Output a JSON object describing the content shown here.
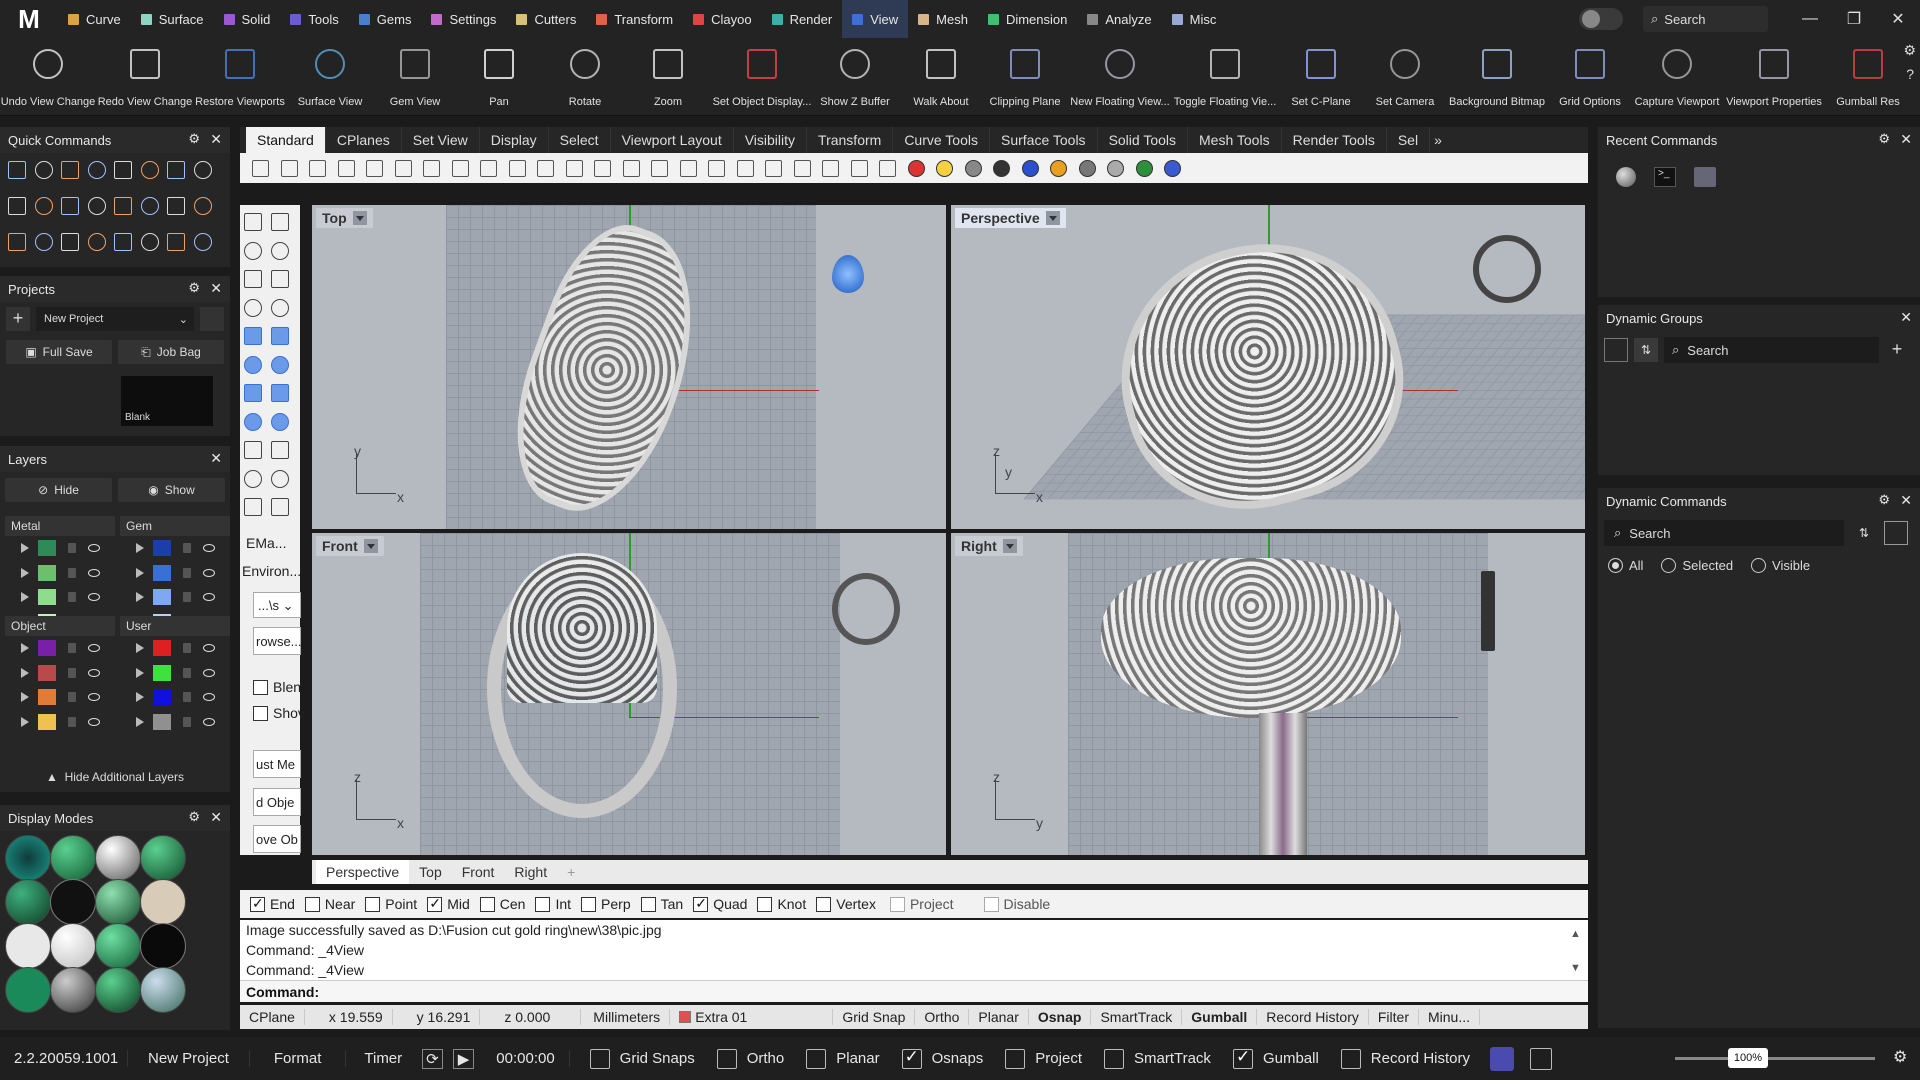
{
  "menu": {
    "logo": "M",
    "tabs": [
      {
        "label": "Curve",
        "color": "#d9a441"
      },
      {
        "label": "Surface",
        "color": "#8fd3c1"
      },
      {
        "label": "Solid",
        "color": "#9b59d0"
      },
      {
        "label": "Tools",
        "color": "#6a5ecf"
      },
      {
        "label": "Gems",
        "color": "#4a7fd0"
      },
      {
        "label": "Settings",
        "color": "#c46acb"
      },
      {
        "label": "Cutters",
        "color": "#d8c07a"
      },
      {
        "label": "Transform",
        "color": "#e0614a"
      },
      {
        "label": "Clayoo",
        "color": "#e04545"
      },
      {
        "label": "Render",
        "color": "#3ab0a8"
      },
      {
        "label": "View",
        "color": "#3d6fd6"
      },
      {
        "label": "Mesh",
        "color": "#d8b48a"
      },
      {
        "label": "Dimension",
        "color": "#3fbf6f"
      },
      {
        "label": "Analyze",
        "color": "#888888"
      },
      {
        "label": "Misc",
        "color": "#9aa8d6"
      }
    ],
    "search_placeholder": "Search"
  },
  "ribbon": [
    {
      "label": "Undo View Change",
      "icon": "undo-view-icon"
    },
    {
      "label": "Redo View Change",
      "icon": "redo-view-icon"
    },
    {
      "label": "Restore Viewports",
      "icon": "restore-viewports-icon"
    },
    {
      "label": "Surface View",
      "icon": "surface-view-icon"
    },
    {
      "label": "Gem View",
      "icon": "gem-view-icon"
    },
    {
      "label": "Pan",
      "icon": "pan-hand-icon"
    },
    {
      "label": "Rotate",
      "icon": "rotate-icon"
    },
    {
      "label": "Zoom",
      "icon": "zoom-icon"
    },
    {
      "label": "Set Object Display...",
      "icon": "object-display-icon"
    },
    {
      "label": "Show Z Buffer",
      "icon": "z-buffer-icon"
    },
    {
      "label": "Walk About",
      "icon": "walk-about-icon"
    },
    {
      "label": "Clipping Plane",
      "icon": "clipping-plane-icon"
    },
    {
      "label": "New Floating View...",
      "icon": "floating-view-icon"
    },
    {
      "label": "Toggle Floating Vie...",
      "icon": "toggle-floating-icon"
    },
    {
      "label": "Set C-Plane",
      "icon": "cplane-icon"
    },
    {
      "label": "Set Camera",
      "icon": "camera-icon"
    },
    {
      "label": "Background Bitmap",
      "icon": "background-bitmap-icon"
    },
    {
      "label": "Grid Options",
      "icon": "grid-options-icon"
    },
    {
      "label": "Capture Viewport",
      "icon": "capture-viewport-icon"
    },
    {
      "label": "Viewport Properties",
      "icon": "viewport-properties-icon"
    },
    {
      "label": "Gumball Res",
      "icon": "gumball-icon"
    }
  ],
  "quick_commands": {
    "title": "Quick Commands"
  },
  "projects": {
    "title": "Projects",
    "project_name": "New Project",
    "full_save": "Full Save",
    "job_bag": "Job Bag",
    "thumb_label": "Blank"
  },
  "layers": {
    "title": "Layers",
    "hide": "Hide",
    "show": "Show",
    "groups": [
      {
        "name": "Metal",
        "colors": [
          "#2e8b57",
          "#6dbf6d",
          "#8fdc8f",
          "#c4f0c4"
        ]
      },
      {
        "name": "Gem",
        "colors": [
          "#1a3fa8",
          "#3a6fd6",
          "#7fa8f0",
          "#b8cff7"
        ]
      },
      {
        "name": "Object",
        "colors": [
          "#7a1fa8",
          "#b84a4a",
          "#e07b3a",
          "#f0c050"
        ]
      },
      {
        "name": "User",
        "colors": [
          "#e02020",
          "#40e040",
          "#1010e0",
          "#909090"
        ]
      }
    ],
    "hide_additional": "Hide Additional Layers"
  },
  "display_modes": {
    "title": "Display Modes"
  },
  "main_tabs": [
    "Standard",
    "CPlanes",
    "Set View",
    "Display",
    "Select",
    "Viewport Layout",
    "Visibility",
    "Transform",
    "Curve Tools",
    "Surface Tools",
    "Solid Tools",
    "Mesh Tools",
    "Render Tools",
    "Sel"
  ],
  "left_tools": {
    "label1": "EMa...",
    "label2": "Environ...",
    "select_value": "...\\s",
    "browse": "rowse...",
    "cb1": "Blen",
    "cb2": "Shov",
    "btn1": "ust Me",
    "btn2": "d Obje",
    "btn3": "ove Ob"
  },
  "viewports": [
    {
      "name": "Top",
      "axes": [
        "y",
        "x"
      ]
    },
    {
      "name": "Perspective",
      "axes": [
        "z",
        "y",
        "x"
      ]
    },
    {
      "name": "Front",
      "axes": [
        "z",
        "x"
      ]
    },
    {
      "name": "Right",
      "axes": [
        "z",
        "y"
      ]
    }
  ],
  "viewport_tabs": [
    "Perspective",
    "Top",
    "Front",
    "Right"
  ],
  "osnaps": [
    {
      "label": "End",
      "checked": true
    },
    {
      "label": "Near",
      "checked": false
    },
    {
      "label": "Point",
      "checked": false
    },
    {
      "label": "Mid",
      "checked": true
    },
    {
      "label": "Cen",
      "checked": false
    },
    {
      "label": "Int",
      "checked": false
    },
    {
      "label": "Perp",
      "checked": false
    },
    {
      "label": "Tan",
      "checked": false
    },
    {
      "label": "Quad",
      "checked": true
    },
    {
      "label": "Knot",
      "checked": false
    },
    {
      "label": "Vertex",
      "checked": false
    },
    {
      "label": "Project",
      "checked": false,
      "disabled": true
    },
    {
      "label": "Disable",
      "checked": false,
      "disabled": true
    }
  ],
  "command_history": [
    "Image successfully saved as D:\\Fusion cut gold ring\\new\\38\\pic.jpg",
    "Command: _4View",
    "Command: _4View"
  ],
  "command_prompt": "Command:",
  "status": {
    "cplane": "CPlane",
    "x": "x 19.559",
    "y": "y 16.291",
    "z": "z 0.000",
    "units": "Millimeters",
    "layer": "Extra 01",
    "layer_color": "#e05050",
    "toggles": [
      {
        "label": "Grid Snap",
        "bold": false
      },
      {
        "label": "Ortho",
        "bold": false
      },
      {
        "label": "Planar",
        "bold": false
      },
      {
        "label": "Osnap",
        "bold": true
      },
      {
        "label": "SmartTrack",
        "bold": false
      },
      {
        "label": "Gumball",
        "bold": true
      },
      {
        "label": "Record History",
        "bold": false
      },
      {
        "label": "Filter",
        "bold": false
      },
      {
        "label": "Minu...",
        "bold": false
      }
    ]
  },
  "recent_commands": {
    "title": "Recent Commands"
  },
  "dynamic_groups": {
    "title": "Dynamic Groups",
    "search": "Search"
  },
  "dynamic_commands": {
    "title": "Dynamic Commands",
    "search": "Search",
    "radios": [
      {
        "label": "All",
        "checked": true
      },
      {
        "label": "Selected",
        "checked": false
      },
      {
        "label": "Visible",
        "checked": false
      }
    ]
  },
  "bottom": {
    "version": "2.2.20059.1001",
    "project": "New Project",
    "format": "Format",
    "timer": "Timer",
    "time": "00:00:00",
    "toggles": [
      {
        "label": "Grid Snaps",
        "checked": false
      },
      {
        "label": "Ortho",
        "checked": false
      },
      {
        "label": "Planar",
        "checked": false
      },
      {
        "label": "Osnaps",
        "checked": true
      },
      {
        "label": "Project",
        "checked": false
      },
      {
        "label": "SmartTrack",
        "checked": false
      },
      {
        "label": "Gumball",
        "checked": true
      },
      {
        "label": "Record History",
        "checked": false
      }
    ],
    "zoom": "100%"
  }
}
